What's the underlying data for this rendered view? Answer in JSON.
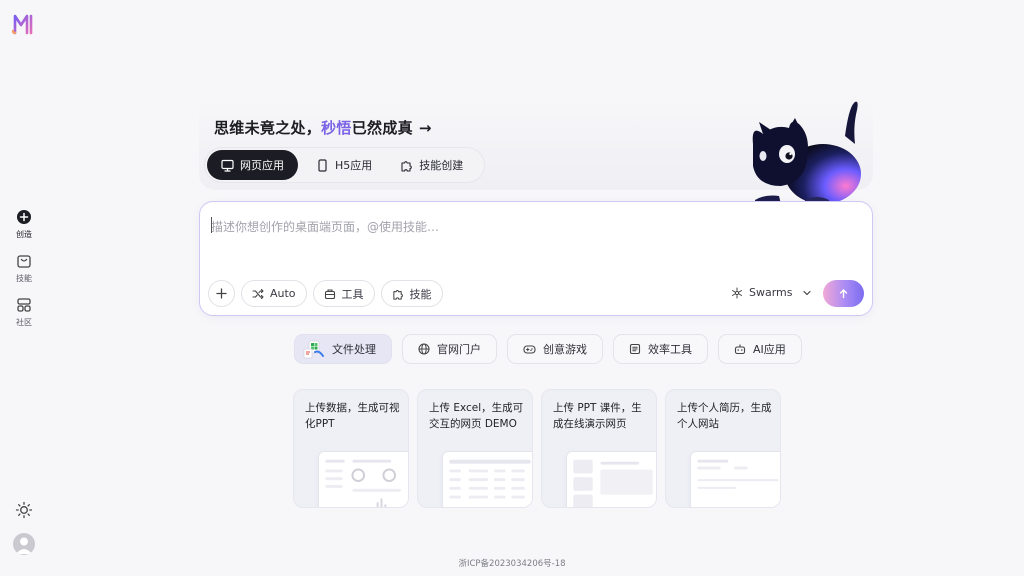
{
  "sidebar": {
    "items": [
      {
        "label": "创造",
        "icon": "plus-circle-icon"
      },
      {
        "label": "技能",
        "icon": "bag-icon"
      },
      {
        "label": "社区",
        "icon": "grid-icon"
      }
    ]
  },
  "hero": {
    "headline_pre": "思维未竟之处，",
    "headline_highlight": "秒悟",
    "headline_post": "已然成真",
    "arrow": "→",
    "tabs": [
      {
        "label": "网页应用",
        "icon": "monitor-icon"
      },
      {
        "label": "H5应用",
        "icon": "phone-icon"
      },
      {
        "label": "技能创建",
        "icon": "puzzle-icon"
      }
    ]
  },
  "prompt": {
    "placeholder": "描述你想创作的桌面端页面，@使用技能…",
    "tools": [
      {
        "label": "Auto",
        "icon": "shuffle-icon"
      },
      {
        "label": "工具",
        "icon": "toolbox-icon"
      },
      {
        "label": "技能",
        "icon": "puzzle-icon"
      }
    ],
    "model": "Swarms"
  },
  "categories": [
    {
      "label": "文件处理"
    },
    {
      "label": "官网门户"
    },
    {
      "label": "创意游戏"
    },
    {
      "label": "效率工具"
    },
    {
      "label": "AI应用"
    }
  ],
  "samples": [
    {
      "text": "上传数据，生成可视化PPT"
    },
    {
      "text": "上传 Excel，生成可交互的网页 DEMO"
    },
    {
      "text": "上传 PPT 课件，生成在线演示网页"
    },
    {
      "text": "上传个人简历，生成个人网站"
    }
  ],
  "footer": {
    "icp": "浙ICP备2023034206号-18"
  },
  "colors": {
    "accent": "#7b63e6",
    "dark": "#1c1d24",
    "background": "#f7f7f9"
  }
}
